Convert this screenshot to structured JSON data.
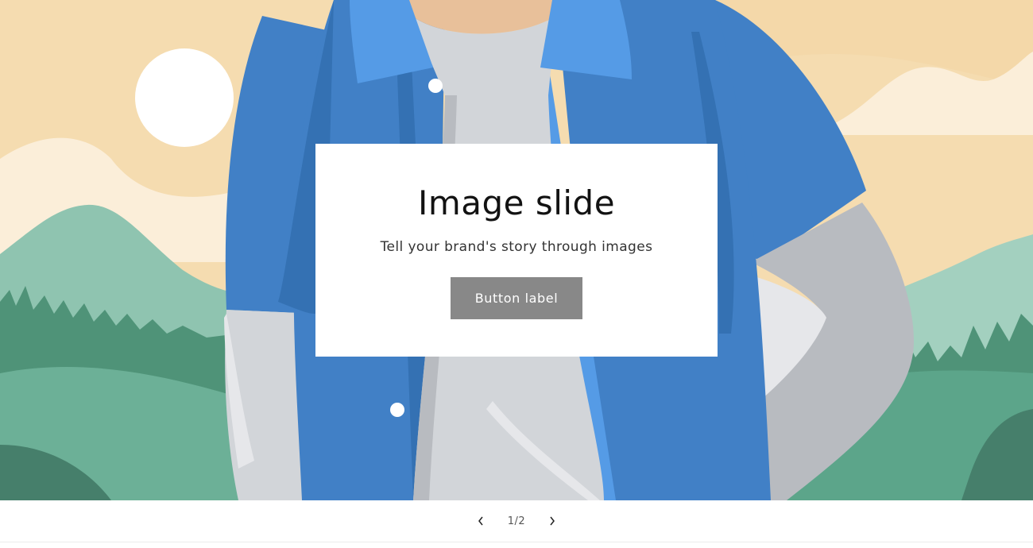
{
  "slideshow": {
    "slide": {
      "heading": "Image slide",
      "subheading": "Tell your brand's story through images",
      "button_label": "Button label"
    },
    "counter": "1/2",
    "prev_icon": "chevron-left-icon",
    "next_icon": "chevron-right-icon"
  },
  "colors": {
    "sky": "#f5dcb0",
    "sun": "#ffffff",
    "shirt": "#4180c6",
    "shirt_light": "#559be6",
    "tee": "#d2d5d9",
    "hills": "#5ca58a",
    "button": "#888888"
  }
}
